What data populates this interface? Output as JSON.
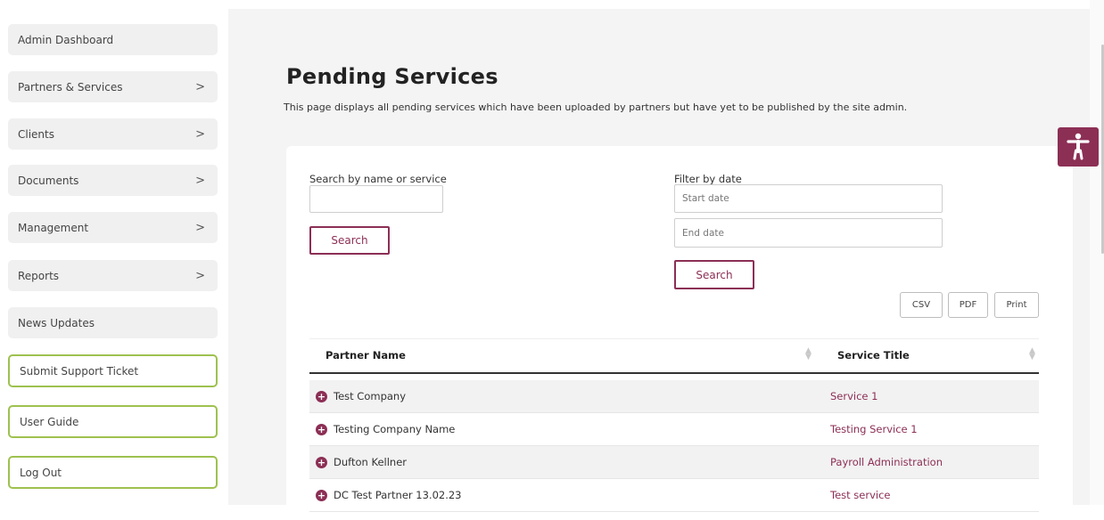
{
  "header": {
    "title_fragment": "g"
  },
  "sidebar": {
    "items": [
      {
        "label": "Admin Dashboard",
        "chevron": ""
      },
      {
        "label": "Partners & Services",
        "chevron": ">"
      },
      {
        "label": "Clients",
        "chevron": ">"
      },
      {
        "label": "Documents",
        "chevron": ">"
      },
      {
        "label": "Management",
        "chevron": ">"
      },
      {
        "label": "Reports",
        "chevron": ">"
      },
      {
        "label": "News Updates",
        "chevron": ""
      },
      {
        "label": "Submit Support Ticket",
        "chevron": ""
      },
      {
        "label": "User Guide",
        "chevron": ""
      },
      {
        "label": "Log Out",
        "chevron": ""
      }
    ]
  },
  "page": {
    "title": "Pending Services",
    "description": "This page displays all pending services which have been uploaded by partners but have yet to be published by the site admin."
  },
  "search": {
    "name_label": "Search by name or service",
    "name_value": "",
    "search_button": "Search",
    "date_label": "Filter by date",
    "start_placeholder": "Start date",
    "end_placeholder": "End date",
    "date_search_button": "Search"
  },
  "export": {
    "csv": "CSV",
    "pdf": "PDF",
    "print": "Print"
  },
  "table": {
    "columns": [
      "Partner Name",
      "Service Title"
    ],
    "rows": [
      {
        "partner": "Test Company",
        "service": "Service 1"
      },
      {
        "partner": "Testing Company Name",
        "service": "Testing Service 1"
      },
      {
        "partner": "Dufton Kellner",
        "service": "Payroll Administration"
      },
      {
        "partner": "DC Test Partner 13.02.23",
        "service": "Test service"
      }
    ]
  },
  "icons": {
    "expand_row": "plus-circle-icon",
    "accessibility": "accessibility-person-icon",
    "chevron": "chevron-right-icon",
    "sort": "sort-arrows-icon"
  },
  "colors": {
    "accent": "#8c2f55",
    "outline_green": "#9ec14f",
    "page_bg": "#f4f4f4",
    "nav_bg": "#f0f0f0"
  }
}
